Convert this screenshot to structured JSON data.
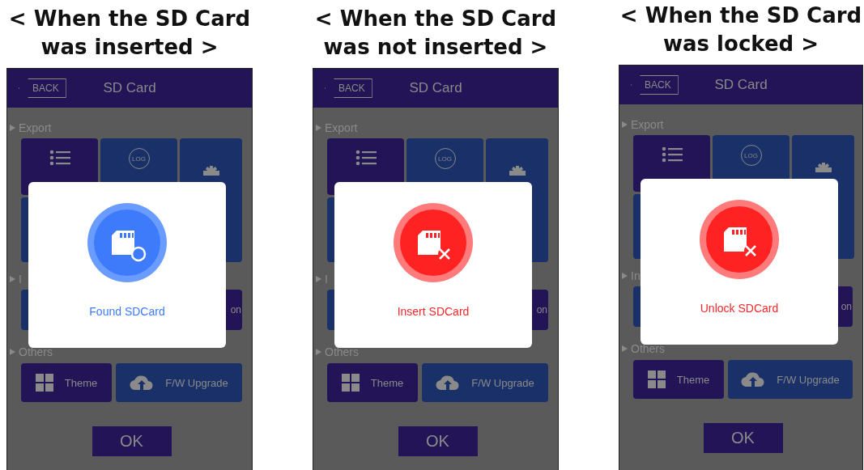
{
  "panels": [
    {
      "heading": [
        "< When the SD Card",
        "was inserted >"
      ],
      "back": "BACK",
      "title": "SD Card",
      "sections": [
        "Export",
        "I",
        "Others"
      ],
      "log": "LOG",
      "tile_text": "on",
      "theme": "Theme",
      "upgrade": "F/W Upgrade",
      "ok": "OK",
      "dialog": {
        "kind": "found",
        "message": "Found SDCard"
      }
    },
    {
      "heading": [
        "< When the SD Card",
        "was not inserted >"
      ],
      "back": "BACK",
      "title": "SD Card",
      "sections": [
        "Export",
        "I",
        "Others"
      ],
      "log": "LOG",
      "tile_text": "on",
      "theme": "Theme",
      "upgrade": "F/W Upgrade",
      "ok": "OK",
      "dialog": {
        "kind": "missing",
        "message": "Insert SDCard"
      }
    },
    {
      "heading": [
        "< When the SD Card",
        "was locked >"
      ],
      "back": "BACK",
      "title": "SD Card",
      "sections": [
        "Export",
        "In",
        "Others"
      ],
      "log": "LOG",
      "tile_text": "on",
      "theme": "Theme",
      "upgrade": "F/W Upgrade",
      "ok": "OK",
      "dialog": {
        "kind": "locked",
        "message": "Unlock SDCard"
      }
    }
  ]
}
